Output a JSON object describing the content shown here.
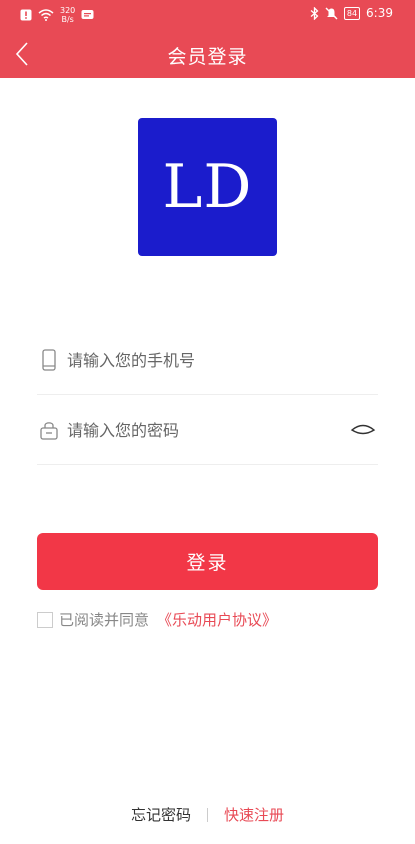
{
  "status_bar": {
    "net_speed_value": "320",
    "net_speed_unit": "B/s",
    "battery": "84",
    "time": "6:39"
  },
  "nav": {
    "title": "会员登录"
  },
  "logo": {
    "text": "LD"
  },
  "form": {
    "phone_placeholder": "请输入您的手机号",
    "password_placeholder": "请输入您的密码",
    "login_label": "登录"
  },
  "agreement": {
    "text": "已阅读并同意",
    "link": "《乐动用户协议》"
  },
  "footer": {
    "forgot": "忘记密码",
    "register": "快速注册"
  },
  "colors": {
    "primary": "#e84a55",
    "button": "#f23747",
    "logo_bg": "#1b1ccc"
  }
}
